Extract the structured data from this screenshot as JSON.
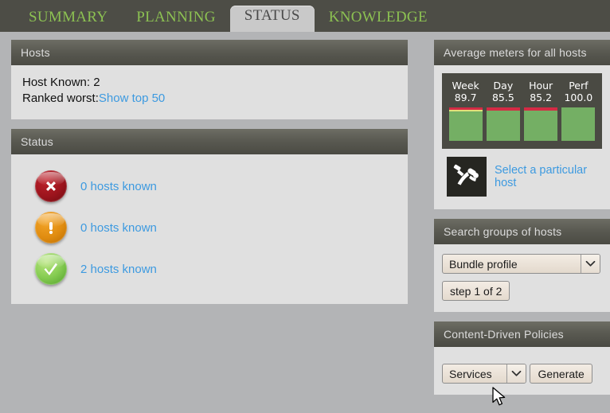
{
  "nav": {
    "tabs": [
      {
        "label": "SUMMARY",
        "active": false
      },
      {
        "label": "PLANNING",
        "active": false
      },
      {
        "label": "STATUS",
        "active": true
      },
      {
        "label": "KNOWLEDGE",
        "active": false
      }
    ]
  },
  "hosts_panel": {
    "title": "Hosts",
    "host_known_label": "Host Known: 2",
    "ranked_worst_label": "Ranked worst:",
    "show_top_link": "Show top 50"
  },
  "status_panel": {
    "title": "Status",
    "rows": [
      {
        "icon": "error-circle-icon",
        "severity": "critical",
        "color": "#9c141d",
        "glyph": "✖",
        "label": "0 hosts known"
      },
      {
        "icon": "warning-circle-icon",
        "severity": "warning",
        "color": "#e08c10",
        "glyph": "!",
        "label": "0 hosts known"
      },
      {
        "icon": "ok-circle-icon",
        "severity": "ok",
        "color": "#86cc52",
        "glyph": "✔",
        "label": "2 hosts known"
      }
    ]
  },
  "meters_panel": {
    "title": "Average meters for all hosts",
    "meters": [
      {
        "name": "Week",
        "value": "89.7",
        "red_pct": 7,
        "yellow_pct": 6,
        "green_pct": 87
      },
      {
        "name": "Day",
        "value": "85.5",
        "red_pct": 10,
        "yellow_pct": 0,
        "green_pct": 90
      },
      {
        "name": "Hour",
        "value": "85.2",
        "red_pct": 10,
        "yellow_pct": 0,
        "green_pct": 90
      },
      {
        "name": "Perf",
        "value": "100.0",
        "red_pct": 0,
        "yellow_pct": 0,
        "green_pct": 100
      }
    ],
    "select_host_link": "Select a particular host",
    "diver_icon": "scuba-diver-icon"
  },
  "search_panel": {
    "title": "Search groups of hosts",
    "dropdown_value": "Bundle profile",
    "step_button_label": "step 1 of 2"
  },
  "policies_panel": {
    "title": "Content-Driven Policies",
    "dropdown_value": "Services",
    "generate_button_label": "Generate"
  },
  "theme": {
    "accent_green": "#8cc152",
    "link_blue": "#3d9ae0",
    "nav_bg": "#4d4d46",
    "page_bg": "#b3b4b6",
    "panel_body_bg": "#e0e0e0"
  }
}
